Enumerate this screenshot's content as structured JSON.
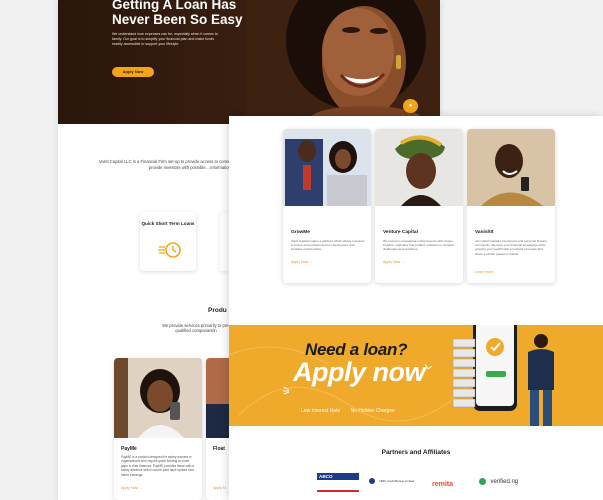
{
  "back_page": {
    "hero": {
      "title": "Getting A Loan Has Never Been So Easy",
      "text": "We understand how expenses can be, especially when it comes to family. Our goal is to simplify your financial plan and make funds readily accessible to support your lifestyle.",
      "button": "Apply Now"
    },
    "about_text": "Varrit Capital LLC is a Financial Firm set-up to provide access to consumer loans, LPO financing... We also provide investors with possible... information on per...",
    "service_card": "Quick Short Term Loans",
    "products_title": "Produ",
    "products_sub": "We provide services primarily to pre-qualified companies/in",
    "products": [
      {
        "name": "PayMe",
        "desc": "PayME is a product designed for salary earners in organizations who require quick funding to cover gaps in their finances. PayME provides these with a salary advance which can be paid back spread over future earnings.",
        "more": "Apply Now →"
      },
      {
        "name": "Float",
        "desc": "",
        "more": "Apply N"
      }
    ]
  },
  "front_page": {
    "cards": [
      {
        "name": "GrowMe",
        "desc": "Varrit Capital makes a platform which allows investors to invest and entrepreneurs in businesses and lucrative opportunities.",
        "more": "Apply Now →"
      },
      {
        "name": "Venture Capital",
        "desc": "We invest in exceptional entrepreneurs with unique insights, originality that proffers solutions to societal challenges and problems.",
        "more": "Apply Now →"
      },
      {
        "name": "VanishIt",
        "desc": "Join Varrit Capital's investment and personal finance community. Develop your financial knowledge while growing your wealth with a network of people that share a similar passion mindset.",
        "more": "Learn more"
      }
    ],
    "banner": {
      "need": "Need a loan?",
      "apply": "Apply now",
      "tag1": "Low Interest Rate",
      "tag2": "No Hidden Charges"
    },
    "partners_title": "Partners and Affiliates",
    "partners": [
      "ABCO INSURANCE",
      "NDIC Credit Bureau Limited",
      "remita",
      "verified.ng"
    ]
  }
}
